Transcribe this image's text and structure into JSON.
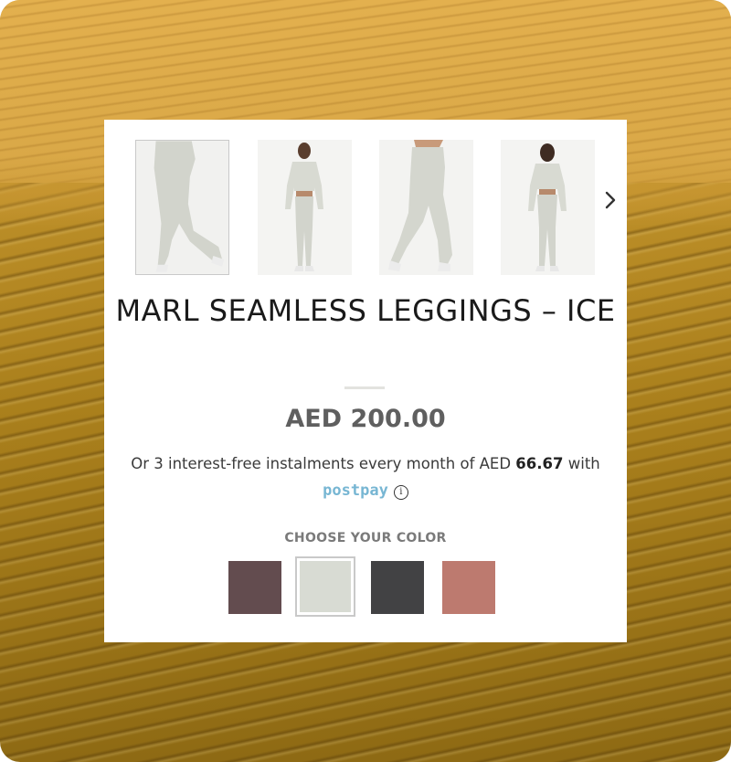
{
  "product": {
    "title": "MARL SEAMLESS LEGGINGS – ICE",
    "price": "AED 200.00",
    "instalment_prefix": "Or 3 interest-free instalments every month of AED ",
    "instalment_amount": "66.67",
    "instalment_suffix": " with",
    "postpay_label": "postpay",
    "info_glyph": "i"
  },
  "gallery": {
    "thumbnails": [
      {
        "name": "leggings-back-view",
        "selected": true
      },
      {
        "name": "full-outfit-front",
        "selected": false
      },
      {
        "name": "leggings-front-view",
        "selected": false
      },
      {
        "name": "full-outfit-back",
        "selected": false
      }
    ],
    "next_icon": "chevron-right-icon"
  },
  "color_picker": {
    "label": "CHOOSE YOUR COLOR",
    "swatches": [
      {
        "name": "mauve-brown",
        "color": "#634c4f",
        "selected": false
      },
      {
        "name": "ice",
        "color": "#d8dbd3",
        "selected": true
      },
      {
        "name": "charcoal",
        "color": "#424244",
        "selected": false
      },
      {
        "name": "terracotta",
        "color": "#bd7a6f",
        "selected": false
      }
    ]
  },
  "colors": {
    "postpay": "#77b6d3",
    "price": "#5f5f5f",
    "title": "#1a1a1a"
  }
}
